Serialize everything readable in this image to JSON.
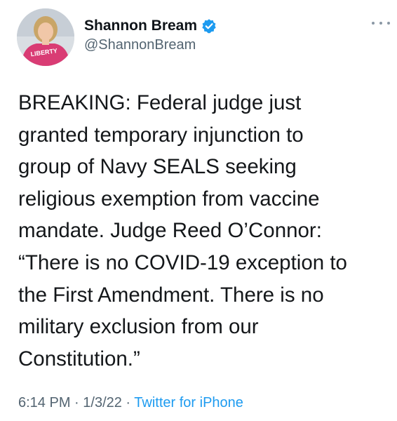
{
  "author": {
    "display_name": "Shannon Bream",
    "handle": "@ShannonBream",
    "verified": true,
    "avatar_shirt_text": "LIBERTY"
  },
  "tweet": {
    "text": "BREAKING:  Federal judge just\ngranted temporary injunction to\ngroup of Navy SEALS seeking\nreligious exemption from vaccine\nmandate. Judge Reed O’Connor:\n“There is no COVID-19 exception to\nthe First Amendment. There is no\nmilitary exclusion from our\nConstitution.”"
  },
  "meta": {
    "time": "6:14 PM",
    "separator": " · ",
    "date": "1/3/22",
    "source": "Twitter for iPhone"
  },
  "colors": {
    "verified_badge": "#1d9bf0",
    "source_link": "#1d9bf0",
    "secondary_text": "#536471"
  },
  "icons": {
    "verified": "verified-badge-icon",
    "more": "more-options-icon"
  }
}
